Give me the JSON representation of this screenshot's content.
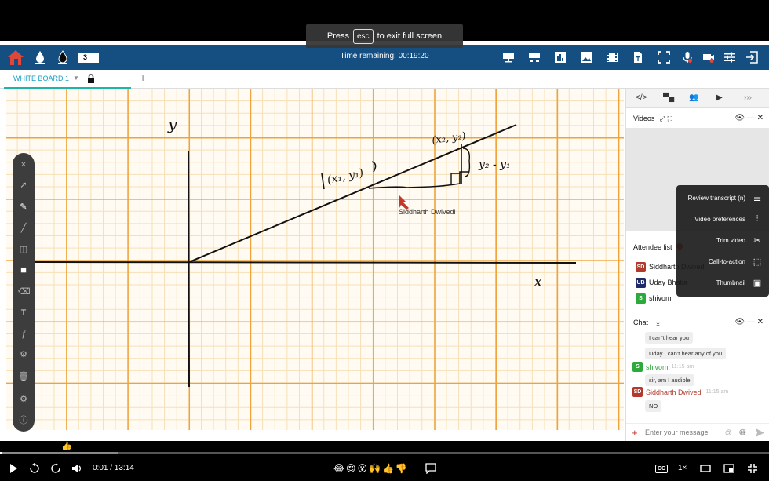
{
  "banner": {
    "press": "Press",
    "key": "esc",
    "rest": "to exit full screen"
  },
  "topbar": {
    "pen_size": "3",
    "timer": "Time remaining: 00:19:20",
    "accent": "#154e80"
  },
  "tabs": {
    "whiteboard": "WHITE BOARD 1",
    "add": "+"
  },
  "board": {
    "labels": {
      "y_axis": "y",
      "x_axis": "x",
      "point1": "(x₁, y₁)",
      "point2": "(x₂, y₂)",
      "delta_y": "y₂ - y₁"
    },
    "cursor_user": "Siddharth Dwivedi"
  },
  "right_panel": {
    "videos_title": "Videos",
    "attendee_title": "Attendee list",
    "attendees": [
      {
        "initials": "SD",
        "name": "Siddharth Dwivedi",
        "color": "#b03a2e"
      },
      {
        "initials": "UB",
        "name": "Uday Bhatia",
        "color": "#1f2a6b"
      },
      {
        "initials": "S",
        "name": "shivom",
        "color": "#2eaa3c"
      }
    ],
    "chat_title": "Chat",
    "chat": {
      "msg1": "I can't hear you",
      "msg2": "Uday I can't hear any of you",
      "sender3": "shivom",
      "time3": "11:15 am",
      "msg3": "sir, am I audible",
      "sender4": "Siddharth Dwivedi",
      "time4": "11:15 am",
      "msg4": "NO"
    },
    "chat_placeholder": "Enter your message"
  },
  "menu": {
    "items": [
      "Review transcript (n)",
      "Video preferences",
      "Trim video",
      "Call-to-action",
      "Thumbnail"
    ]
  },
  "player": {
    "time": "0:01 / 13:14",
    "speed": "1×",
    "reactions": "😂😍😮🙌👍👎",
    "progress_played_fraction": 0.003
  }
}
